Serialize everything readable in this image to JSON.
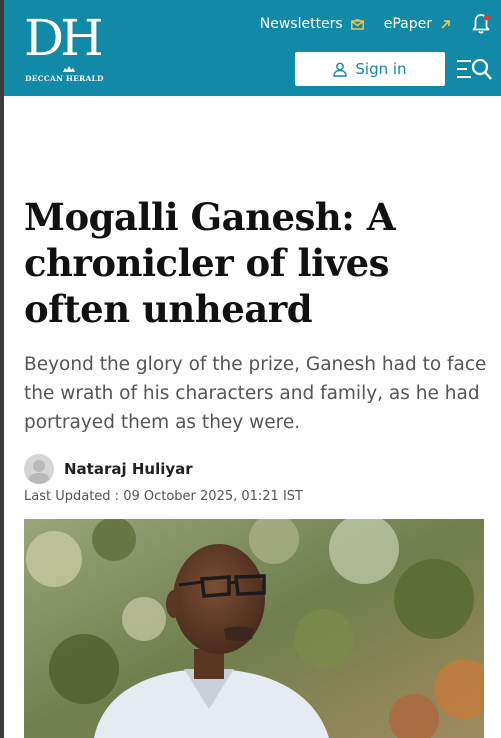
{
  "brand": {
    "logo_text": "DH",
    "logo_subtext": "DECCAN HERALD"
  },
  "header": {
    "newsletters_label": "Newsletters",
    "epaper_label": "ePaper",
    "signin_label": "Sign in",
    "accent_color": "#1289a7",
    "icons": [
      "mail-icon",
      "arrow-up-right-icon",
      "bell-icon",
      "user-icon",
      "menu-search-icon"
    ]
  },
  "article": {
    "headline": "Mogalli Ganesh: A chronicler of lives often unheard",
    "summary": "Beyond the glory of the prize, Ganesh had to face the wrath of his characters and family, as he had portrayed them as they were.",
    "author": "Nataraj Huliyar",
    "last_updated": "Last Updated : 09 October 2025, 01:21 IST"
  }
}
